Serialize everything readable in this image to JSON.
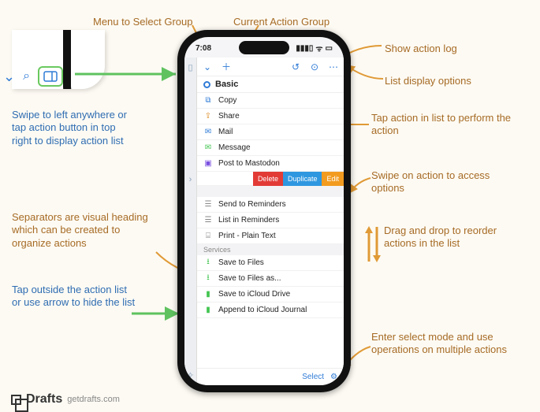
{
  "annotations": {
    "menu_select_group": "Menu to Select Group",
    "current_action_group": "Current Action Group",
    "show_action_log": "Show action log",
    "list_display_options": "List display options",
    "swipe_left": "Swipe to left anywhere or tap action button in top right to display action list",
    "tap_action": "Tap action in list to perform the action",
    "swipe_access": "Swipe on action to access options",
    "separators": "Separators are visual heading which can be created to organize actions",
    "drag_drop": "Drag and drop to reorder actions in the list",
    "tap_outside": "Tap outside the action list or use arrow to hide the list",
    "select_mode": "Enter select mode and use operations on multiple actions"
  },
  "status": {
    "time": "7:08"
  },
  "toolbar": {
    "group_menu_icon": "⌄",
    "add_icon": "＋",
    "history_icon": "↺",
    "log_icon": "⊙",
    "options_icon": "⋯"
  },
  "group_label": "Basic",
  "actions": [
    {
      "icon": "⧉",
      "color": "#2f7bd6",
      "label": "Copy"
    },
    {
      "icon": "⇪",
      "color": "#e0902f",
      "label": "Share"
    },
    {
      "icon": "✉",
      "color": "#2f7bd6",
      "label": "Mail"
    },
    {
      "icon": "✉",
      "color": "#43c552",
      "label": "Message"
    },
    {
      "icon": "▣",
      "color": "#7a4fe0",
      "label": "Post to Mastodon"
    }
  ],
  "swipe": {
    "del": "Delete",
    "dup": "Duplicate",
    "edit": "Edit"
  },
  "actions2": [
    {
      "icon": "☰",
      "color": "#888",
      "label": "Send to Reminders"
    },
    {
      "icon": "☰",
      "color": "#888",
      "label": "List in Reminders"
    },
    {
      "icon": "⌸",
      "color": "#888",
      "label": "Print - Plain Text"
    }
  ],
  "separator_label": "Services",
  "actions3": [
    {
      "icon": "⭳",
      "color": "#43c552",
      "label": "Save to Files"
    },
    {
      "icon": "⭳",
      "color": "#43c552",
      "label": "Save to Files as..."
    },
    {
      "icon": "▮",
      "color": "#43c552",
      "label": "Save to iCloud Drive"
    },
    {
      "icon": "▮",
      "color": "#43c552",
      "label": "Append to iCloud Journal"
    }
  ],
  "footer": {
    "select": "Select",
    "ops_icon": "⚙"
  },
  "brand": {
    "name": "Drafts",
    "url": "getdrafts.com"
  }
}
